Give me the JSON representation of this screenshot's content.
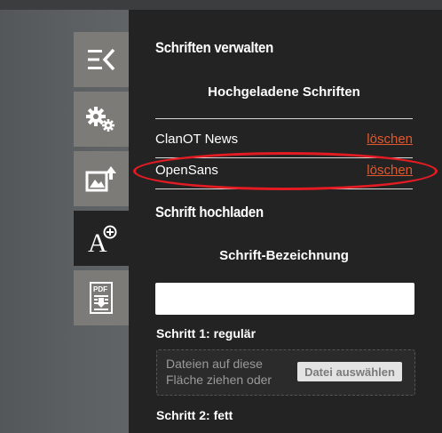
{
  "panel": {
    "title": "Schriften verwalten",
    "uploaded_heading": "Hochgeladene Schriften",
    "fonts": [
      {
        "name": "ClanOT News",
        "delete_label": "löschen"
      },
      {
        "name": "OpenSans",
        "delete_label": "löschen"
      }
    ],
    "upload_title": "Schrift hochladen",
    "name_label": "Schrift-Bezeichnung",
    "name_value": "",
    "step1": "Schritt 1: regulär",
    "dropzone_text": "Dateien auf diese Fläche ziehen oder",
    "choose_file": "Datei auswählen",
    "step2": "Schritt 2: fett"
  },
  "toolbar": {
    "items": [
      {
        "icon": "collapse-menu-icon"
      },
      {
        "icon": "settings-gears-icon"
      },
      {
        "icon": "image-upload-icon"
      },
      {
        "icon": "font-add-icon",
        "active": true
      },
      {
        "icon": "pdf-export-icon"
      }
    ]
  },
  "colors": {
    "panel_bg": "#232323",
    "tool_bg": "#7d7b78",
    "delete_link": "#e0592f",
    "annotation": "#e31b23"
  }
}
